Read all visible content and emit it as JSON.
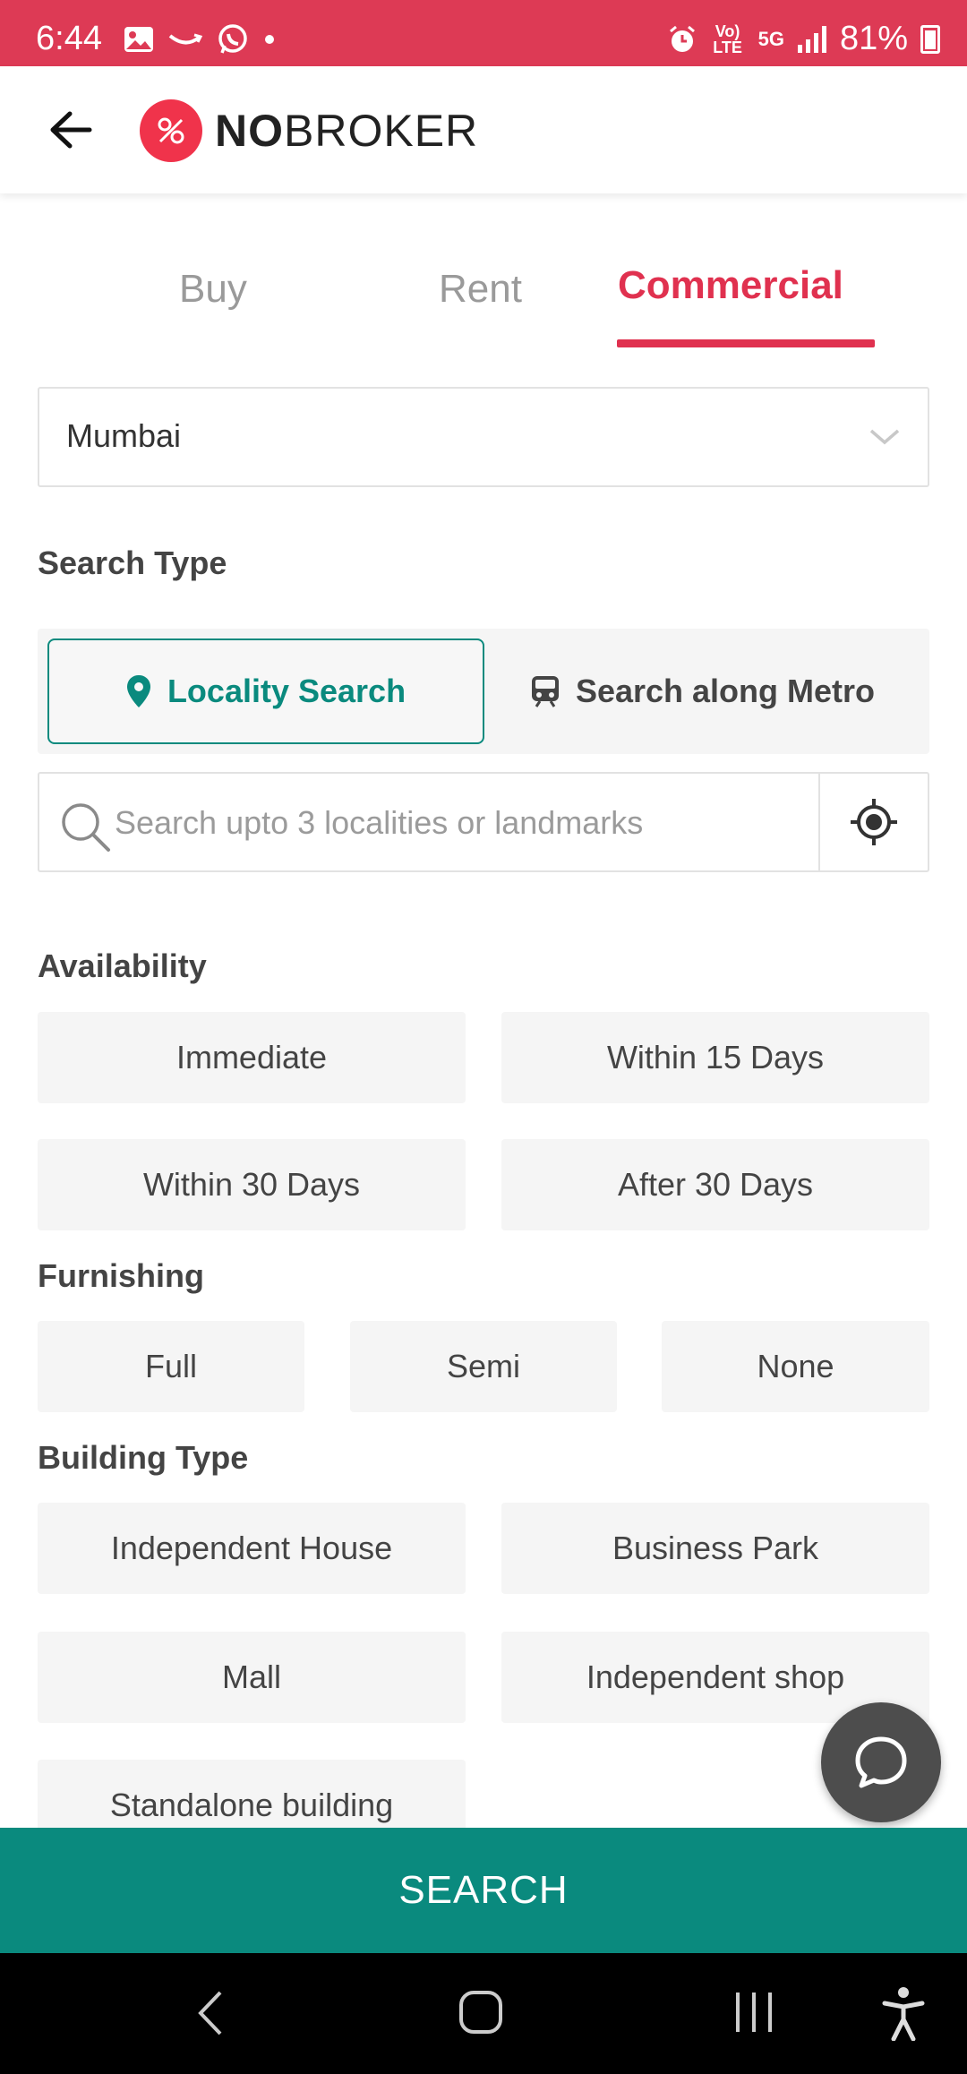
{
  "status_bar": {
    "time": "6:44",
    "battery": "81%",
    "network_small": "Vo) LTE",
    "network_5g": "5G"
  },
  "header": {
    "logo_text_bold": "NO",
    "logo_text_rest": "BROKER"
  },
  "tabs": [
    {
      "label": "Buy",
      "active": false
    },
    {
      "label": "Rent",
      "active": false
    },
    {
      "label": "Commercial",
      "active": true
    }
  ],
  "city_select": {
    "value": "Mumbai"
  },
  "search_type": {
    "title": "Search Type",
    "options": [
      {
        "label": "Locality Search",
        "selected": true,
        "icon": "map-pin-icon"
      },
      {
        "label": "Search along Metro",
        "selected": false,
        "icon": "metro-train-icon"
      }
    ]
  },
  "search": {
    "placeholder": "Search upto 3 localities or landmarks",
    "value": ""
  },
  "availability": {
    "title": "Availability",
    "options": [
      "Immediate",
      "Within 15 Days",
      "Within 30 Days",
      "After 30 Days"
    ]
  },
  "furnishing": {
    "title": "Furnishing",
    "options": [
      "Full",
      "Semi",
      "None"
    ]
  },
  "building_type": {
    "title": "Building Type",
    "options": [
      "Independent House",
      "Business Park",
      "Mall",
      "Independent shop",
      "Standalone building"
    ]
  },
  "search_button": {
    "label": "SEARCH"
  },
  "colors": {
    "brand_red": "#e0314f",
    "status_bar": "#dd3a55",
    "teal": "#0a8a7e",
    "chip_bg": "#f5f5f5"
  }
}
